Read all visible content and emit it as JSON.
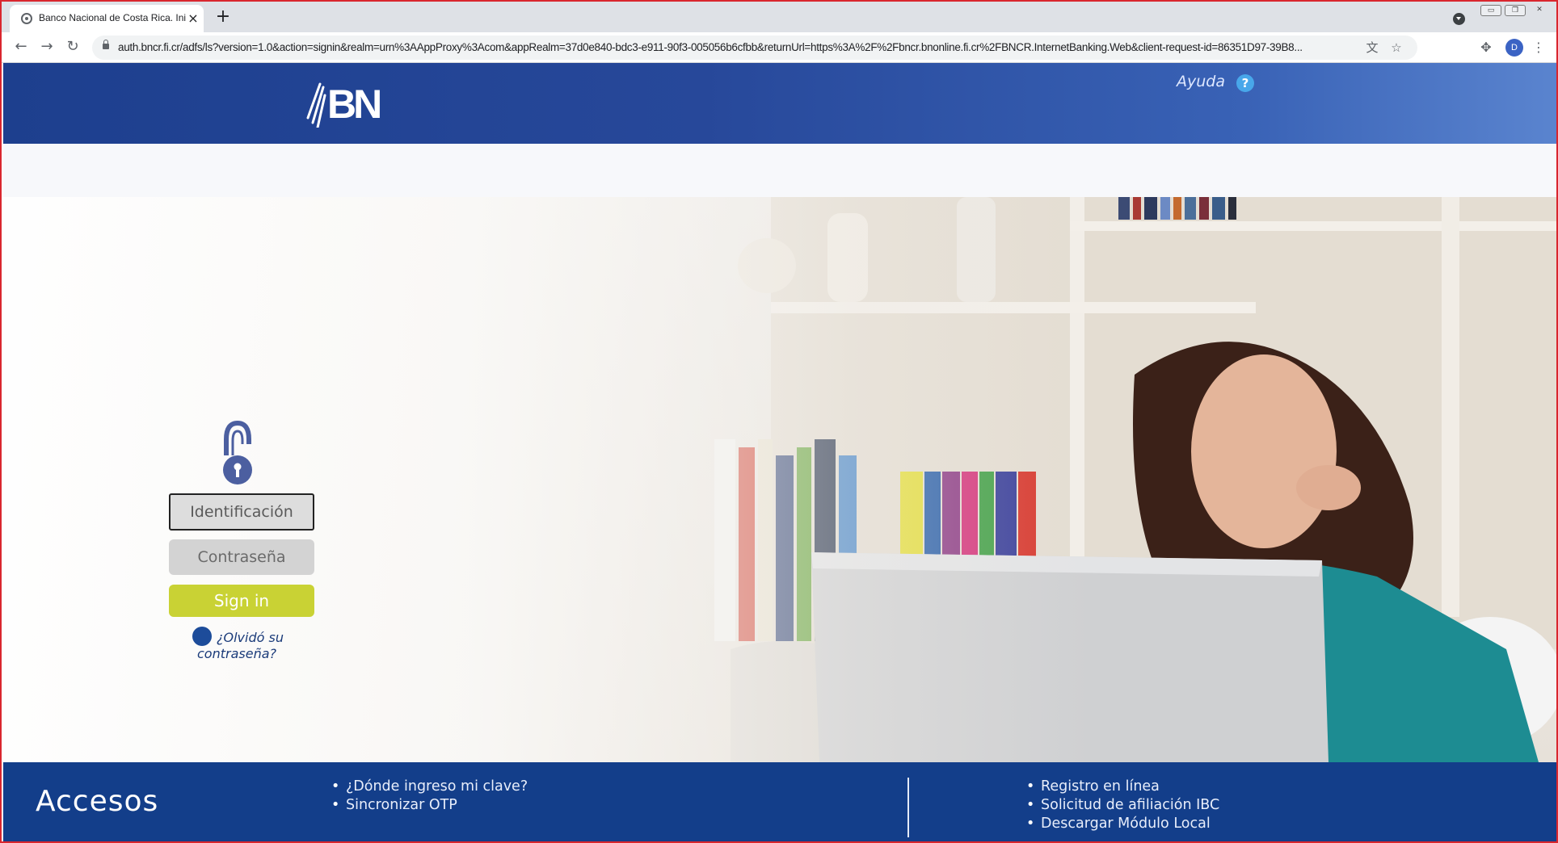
{
  "browser": {
    "tab_title": "Banco Nacional de Costa Rica. Inicio",
    "tab_close": "×",
    "new_tab": "+",
    "url": "auth.bncr.fi.cr/adfs/ls?version=1.0&action=signin&realm=urn%3AAppProxy%3Acom&appRealm=37d0e840-bdc3-e911-90f3-005056b6cfbb&returnUrl=https%3A%2F%2Fbncr.bnonline.fi.cr%2FBNCR.InternetBanking.Web&client-request-id=86351D97-39B8...",
    "profile_initial": "D",
    "icons": {
      "back": "arrow-left",
      "forward": "arrow-right",
      "reload": "reload",
      "translate": "translate",
      "bookmark": "star-outline",
      "extensions": "puzzle",
      "menu": "kebab"
    }
  },
  "header": {
    "logo_text": "BN",
    "help_label": "Ayuda",
    "help_icon": "?",
    "colors": {
      "left": "#1d3f8e",
      "right": "#5a84cf"
    }
  },
  "login": {
    "id_placeholder": "Identificación",
    "password_placeholder": "Contraseña",
    "signin_label": "Sign in",
    "forgot_label": "¿Olvidó su contraseña?",
    "colors": {
      "signin": "#c9d234",
      "padlock": "#4c5fa0"
    }
  },
  "footer": {
    "title": "Accesos",
    "links_left": [
      "¿Dónde ingreso mi clave?",
      "Sincronizar OTP"
    ],
    "links_right": [
      "Registro en línea",
      "Solicitud de afiliación IBC",
      "Descargar Módulo Local"
    ],
    "background": "#133e8a"
  }
}
